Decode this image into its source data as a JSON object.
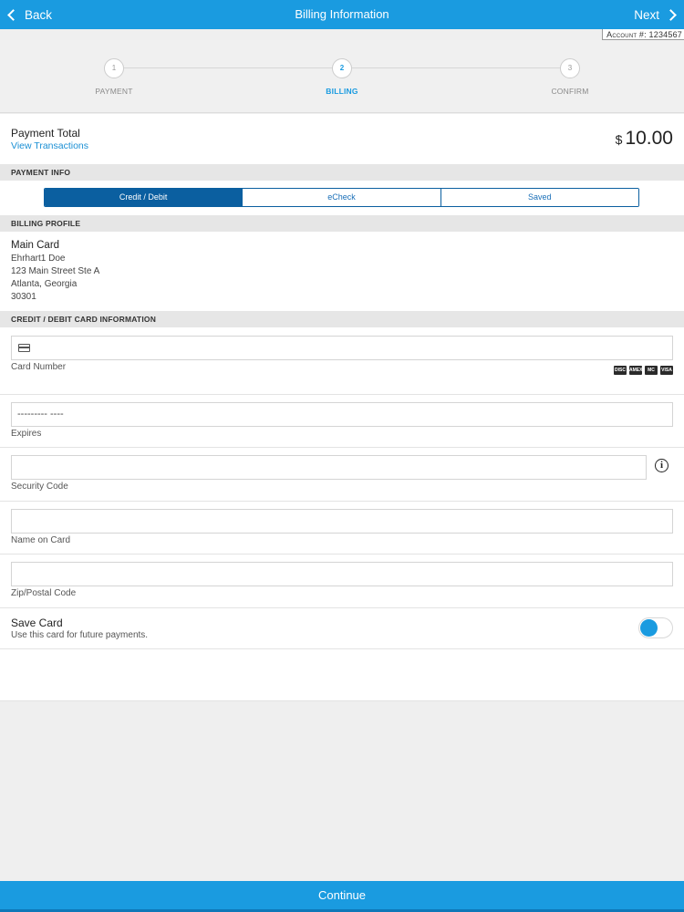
{
  "nav": {
    "back_label": "Back",
    "title": "Billing Information",
    "next_label": "Next"
  },
  "account": {
    "label": "Account #:",
    "number": "1234567"
  },
  "steps": [
    {
      "number": "1",
      "label": "PAYMENT"
    },
    {
      "number": "2",
      "label": "BILLING"
    },
    {
      "number": "3",
      "label": "CONFIRM"
    }
  ],
  "payment_total": {
    "label": "Payment Total",
    "link": "View Transactions",
    "currency": "$",
    "amount": "10.00"
  },
  "payment_info": {
    "header": "PAYMENT INFO",
    "tabs": [
      "Credit / Debit",
      "eCheck",
      "Saved"
    ]
  },
  "billing_profile": {
    "header": "BILLING PROFILE",
    "name": "Main Card",
    "holder": "Ehrhart1 Doe",
    "street": "123 Main Street Ste A",
    "city_state": "Atlanta, Georgia",
    "zip": "30301"
  },
  "card_info": {
    "header": "CREDIT / DEBIT CARD INFORMATION",
    "card_number_label": "Card Number",
    "expires_value": "--------- ----",
    "expires_label": "Expires",
    "security_label": "Security Code",
    "name_label": "Name on Card",
    "zip_label": "Zip/Postal Code",
    "brands": [
      "DISC",
      "AMEX",
      "MC",
      "VISA"
    ]
  },
  "save_card": {
    "title": "Save Card",
    "subtitle": "Use this card for future payments."
  },
  "footer": {
    "continue_label": "Continue"
  },
  "colors": {
    "accent": "#1a9be0",
    "segment": "#0b5fa0"
  }
}
